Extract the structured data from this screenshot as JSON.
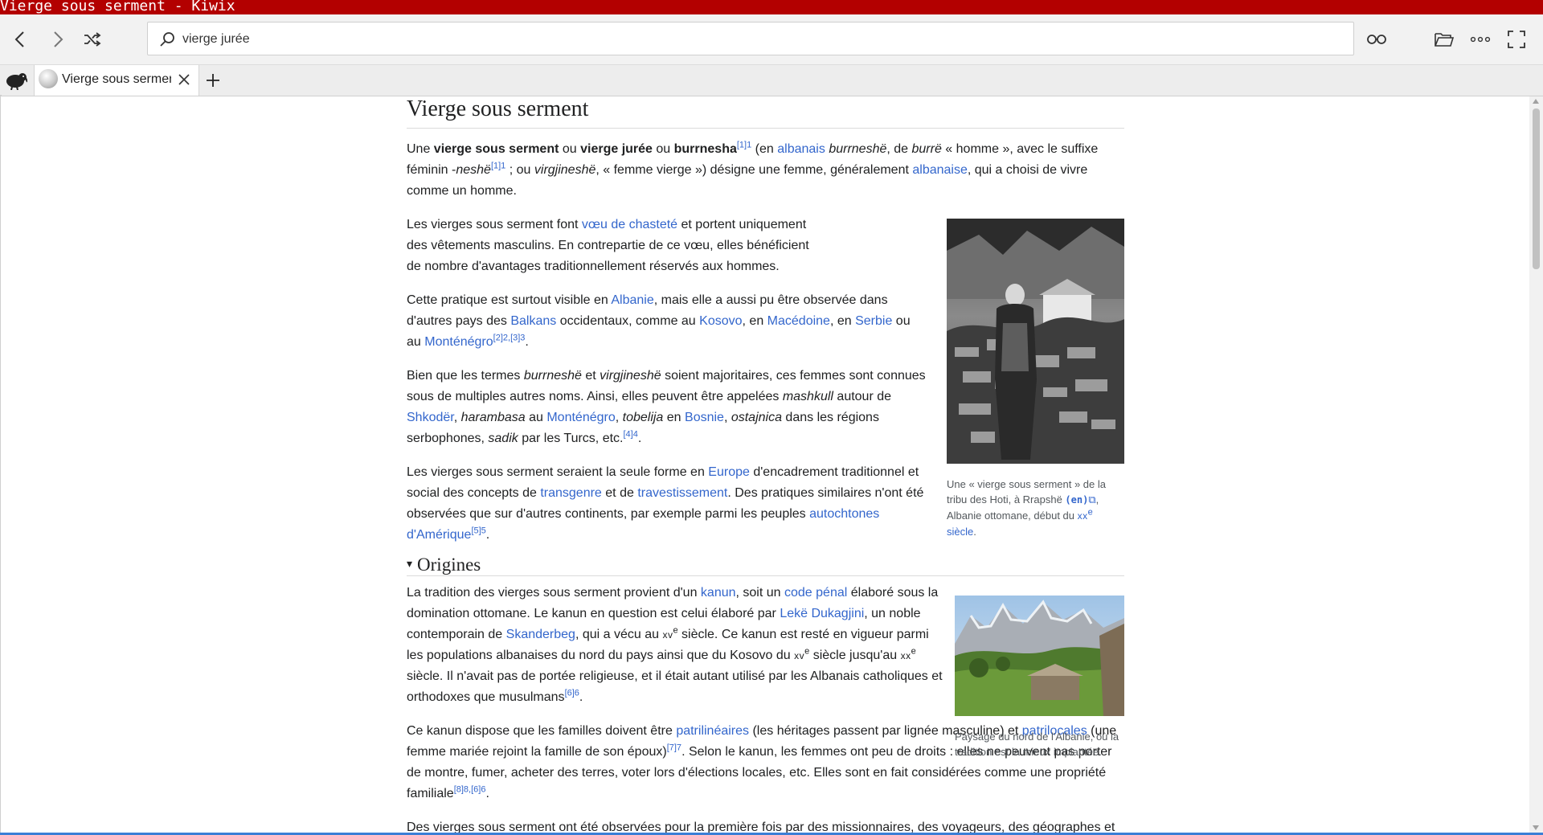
{
  "window": {
    "title": "Vierge sous serment - Kiwix"
  },
  "search": {
    "value": "vierge jurée"
  },
  "tabs": [
    {
      "label": "Vierge sous serment"
    }
  ],
  "article": {
    "title": "Vierge sous serment",
    "intro": {
      "t1": "Une ",
      "b1": "vierge sous serment",
      "t2": " ou ",
      "b2": "vierge jurée",
      "t3": " ou ",
      "b3": "burrnesha",
      "ref1": "[1]1",
      "t4": " (en ",
      "link_albanais": "albanais",
      "i1": "burrneshë",
      "t5": ", de ",
      "i2": "burrë",
      "t6": " « homme », avec le suffixe féminin -",
      "i3": "neshë",
      "ref2": "[1]1",
      "t7": " ; ou ",
      "i4": "virgjineshë",
      "t8": ", « femme vierge ») désigne une femme, généralement ",
      "link_albanaise": "albanaise",
      "t9": ", qui a choisi de vivre comme un homme."
    },
    "p2": {
      "t1": "Les vierges sous serment font ",
      "link": "vœu de chasteté",
      "t2": " et portent uniquement des vêtements masculins. En contrepartie de ce vœu, elles bénéficient de nombre d'avantages traditionnellement réservés aux hommes."
    },
    "p3": {
      "t1": "Cette pratique est surtout visible en ",
      "l1": "Albanie",
      "t2": ", mais elle a aussi pu être observée dans d'autres pays des ",
      "l2": "Balkans",
      "t3": " occidentaux, comme au ",
      "l3": "Kosovo",
      "t4": ", en ",
      "l5": "Macédoine",
      "t5": ", en ",
      "l6": "Serbie",
      "t6": " ou au ",
      "l7": "Monténégro",
      "ref1": "[2]2",
      "sep": ",",
      "ref2": "[3]3",
      "t7": "."
    },
    "p4": {
      "t1": "Bien que les termes ",
      "i1": "burrneshë",
      "t2": " et ",
      "i2": "virgjineshë",
      "t3": " soient majoritaires, ces femmes sont connues sous de multiples autres noms. Ainsi, elles peuvent être appelées ",
      "i3": "mashkull",
      "t4": " autour de ",
      "l1": "Shkodër",
      "t5": ", ",
      "i4": "harambasa",
      "t6": " au ",
      "l2": "Monténégro",
      "t7": ", ",
      "i5": "tobelija",
      "t8": " en ",
      "l3": "Bosnie",
      "t9": ", ",
      "i6": "ostajnica",
      "t10": " dans les régions serbophones, ",
      "i7": "sadik",
      "t11": " par les Turcs, etc.",
      "ref": "[4]4",
      "t12": "."
    },
    "p5": {
      "t1": "Les vierges sous serment seraient la seule forme en ",
      "l1": "Europe",
      "t2": " d'encadrement traditionnel et social des concepts de ",
      "l2": "transgenre",
      "t3": " et de ",
      "l3": "travestissement",
      "t4": ". Des pratiques similaires n'ont été observées que sur d'autres continents, par exemple parmi les peuples ",
      "l4": "autochtones d'Amérique",
      "ref": "[5]5",
      "t5": "."
    },
    "figure1": {
      "caption_t1": "Une « vierge sous serment » de la tribu des Hoti, à Rrapshë ",
      "caption_en": "(en)",
      "caption_ext": "⧉",
      "caption_t2": ", Albanie ottomane, début du ",
      "caption_xx": "xx",
      "caption_e": "e",
      "caption_sp": " ",
      "caption_link": "siècle",
      "caption_t3": "."
    },
    "section_origines": {
      "arrow": "▾",
      "title": "Origines"
    },
    "p6": {
      "t1": "La tradition des vierges sous serment provient d'un ",
      "l1": "kanun",
      "t2": ", soit un ",
      "l2": "code pénal",
      "t3": " élaboré sous la domination ottomane. Le kanun en question est celui élaboré par ",
      "l3": "Lekë Dukagjini",
      "t4": ", un noble contemporain de ",
      "l4": "Skanderbeg",
      "t5": ", qui a vécu au ",
      "sc1": "xv",
      "e1": "e",
      "t6": " siècle. Ce kanun est resté en vigueur parmi les populations albanaises du nord du pays ainsi que du Kosovo du ",
      "sc2": "xv",
      "e2": "e",
      "t7": " siècle jusqu'au ",
      "sc3": "xx",
      "e3": "e",
      "t8": " siècle. Il n'avait pas de portée religieuse, et il était autant utilisé par les Albanais catholiques et orthodoxes que musulmans",
      "ref": "[6]6",
      "t9": "."
    },
    "figure2": {
      "caption": "Paysage du nord de l'Albanie, où la tradition est la mieux implantée."
    },
    "p7": {
      "t1": "Ce kanun dispose que les familles doivent être ",
      "l1": "patrilinéaires",
      "t2": " (les héritages passent par lignée masculine) et ",
      "l2": "patrilocales",
      "t3": " (une femme mariée rejoint la famille de son époux)",
      "ref1": "[7]7",
      "t4": ". Selon le kanun, les femmes ont peu de droits : elles ne peuvent pas porter de montre, fumer, acheter des terres, voter lors d'élections locales, etc. Elles sont en fait considérées comme une propriété familiale",
      "ref2": "[8]8",
      "sep": ",",
      "ref3": "[6]6",
      "t5": "."
    },
    "p8": {
      "t1": "Des vierges sous serment ont été observées pour la première fois par des missionnaires, des voyageurs, des géographes et"
    }
  }
}
